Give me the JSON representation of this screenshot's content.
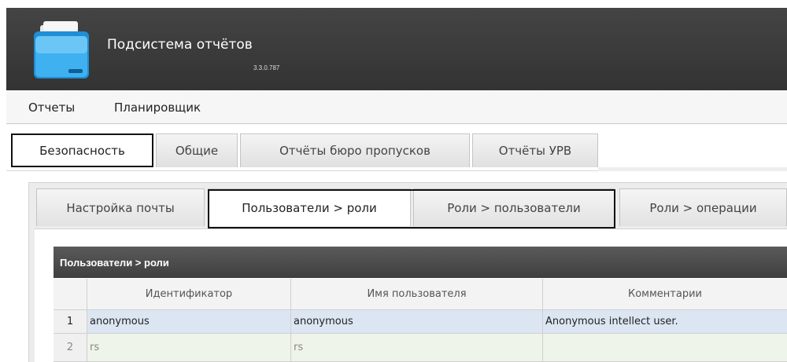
{
  "app": {
    "title": "Подсистема отчётов",
    "version": "3.3.0.787"
  },
  "menu": {
    "items": [
      {
        "label": "Отчеты"
      },
      {
        "label": "Планировщик"
      }
    ]
  },
  "main_tabs": [
    {
      "label": "Безопасность",
      "active": true
    },
    {
      "label": "Общие",
      "active": false
    },
    {
      "label": "Отчёты бюро пропусков",
      "active": false
    },
    {
      "label": "Отчёты УРВ",
      "active": false
    }
  ],
  "sub_tabs": [
    {
      "label": "Настройка почты",
      "active": false
    },
    {
      "label": "Пользователи > роли",
      "active": true
    },
    {
      "label": "Роли > пользователи",
      "active": false
    },
    {
      "label": "Роли > операции",
      "active": false
    }
  ],
  "grid": {
    "title": "Пользователи > роли",
    "columns": [
      "",
      "Идентификатор",
      "Имя пользователя",
      "Комментарии"
    ],
    "rows": [
      {
        "num": "1",
        "id": "anonymous",
        "name": "anonymous",
        "comment": "Anonymous intellect user.",
        "selected": true
      },
      {
        "num": "2",
        "id": "rs",
        "name": "rs",
        "comment": "",
        "selected": false
      }
    ]
  },
  "colors": {
    "header_bg": "#3a3a3a",
    "selected_row": "#dce6f2",
    "alt_row": "#eef4e9",
    "grid_title_bg": "#4a4a4a"
  }
}
